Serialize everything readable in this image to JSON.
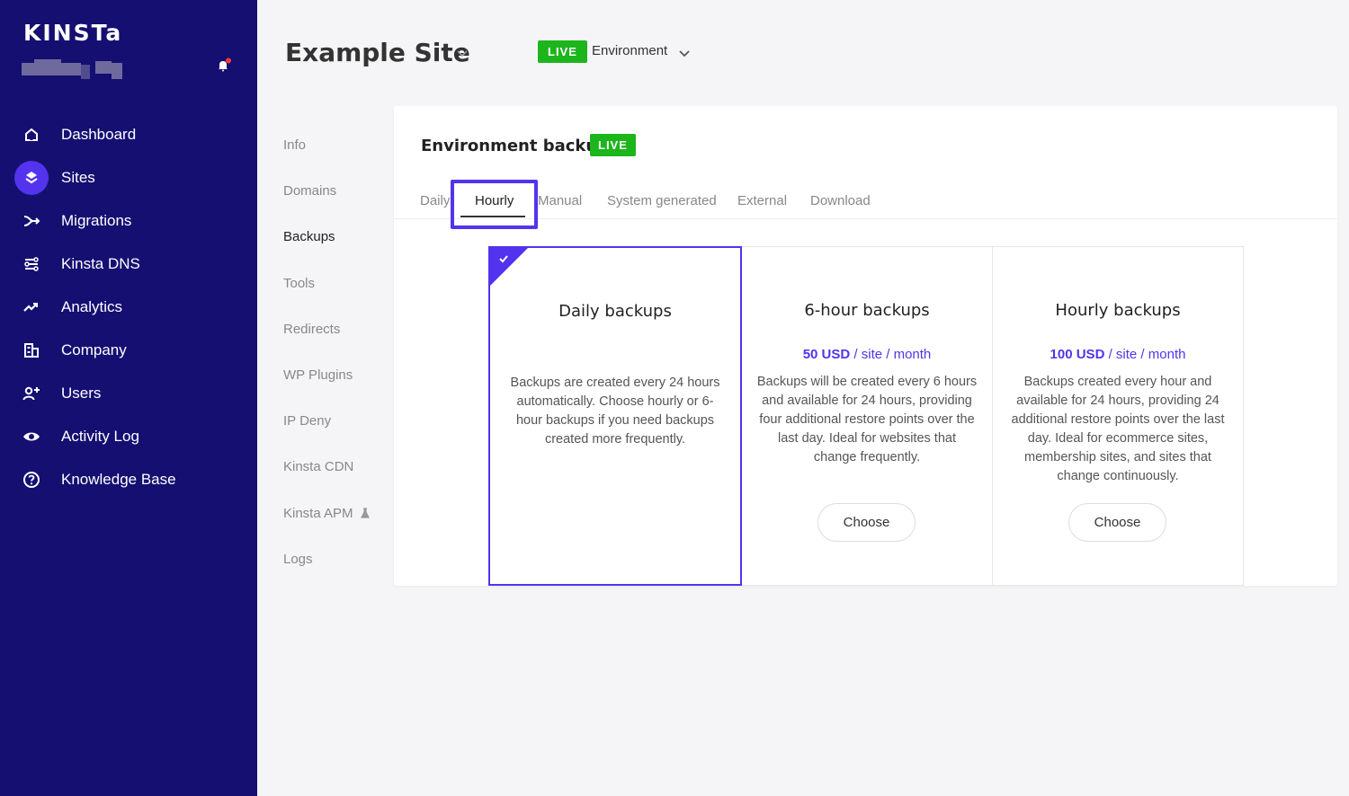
{
  "brand": {
    "logo": "KINSTa"
  },
  "sidebar": {
    "items": [
      {
        "label": "Dashboard",
        "icon": "home-icon"
      },
      {
        "label": "Sites",
        "icon": "layers-icon",
        "active": true
      },
      {
        "label": "Migrations",
        "icon": "migrations-icon"
      },
      {
        "label": "Kinsta DNS",
        "icon": "dns-icon"
      },
      {
        "label": "Analytics",
        "icon": "analytics-icon"
      },
      {
        "label": "Company",
        "icon": "company-icon"
      },
      {
        "label": "Users",
        "icon": "add-user-icon"
      },
      {
        "label": "Activity Log",
        "icon": "eye-icon"
      },
      {
        "label": "Knowledge Base",
        "icon": "help-icon"
      }
    ]
  },
  "header": {
    "site_title": "Example Site",
    "env_badge": "LIVE",
    "env_label": "Environment"
  },
  "subnav": {
    "items": [
      "Info",
      "Domains",
      "Backups",
      "Tools",
      "Redirects",
      "WP Plugins",
      "IP Deny",
      "Kinsta CDN",
      "Kinsta APM",
      "Logs"
    ],
    "active": "Backups"
  },
  "panel": {
    "title": "Environment backups",
    "badge": "LIVE",
    "tabs": [
      "Daily",
      "Hourly",
      "Manual",
      "System generated",
      "External",
      "Download"
    ],
    "active_tab": "Hourly"
  },
  "cards": [
    {
      "title": "Daily backups",
      "description": "Backups are created every 24 hours automatically. Choose hourly or 6-hour backups if you need backups created more frequently.",
      "selected": true
    },
    {
      "title": "6-hour backups",
      "price": "50 USD",
      "price_unit": "/ site / month",
      "description": "Backups will be created every 6 hours and available for 24 hours, providing four additional restore points over the last day. Ideal for websites that change frequently.",
      "button": "Choose"
    },
    {
      "title": "Hourly backups",
      "price": "100 USD",
      "price_unit": "/ site / month",
      "description": "Backups created every hour and available for 24 hours, providing 24 additional restore points over the last day. Ideal for ecommerce sites, membership sites, and sites that change continuously.",
      "button": "Choose"
    }
  ],
  "colors": {
    "sidebar": "#150f72",
    "accent": "#5333ed",
    "live": "#1cb51c"
  }
}
